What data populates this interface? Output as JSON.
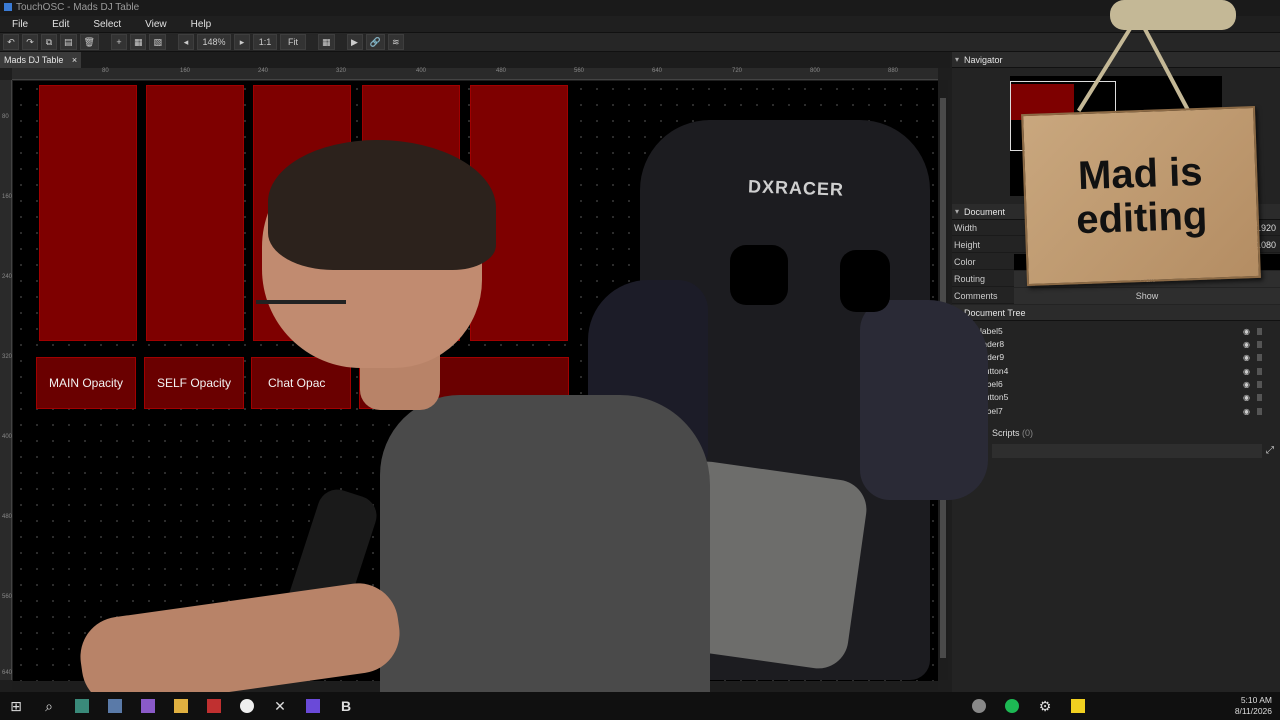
{
  "window": {
    "title": "TouchOSC - Mads DJ Table"
  },
  "menu": [
    "File",
    "Edit",
    "Select",
    "View",
    "Help"
  ],
  "toolbar": {
    "zoom": "148%",
    "one_to_one": "1:1",
    "fit": "Fit"
  },
  "document_tab": {
    "label": "Mads DJ Table",
    "close": "×"
  },
  "ruler_top": [
    "80",
    "160",
    "240",
    "320",
    "400",
    "480",
    "560",
    "640",
    "720",
    "800",
    "880"
  ],
  "ruler_left": [
    "80",
    "160",
    "240",
    "320",
    "400",
    "480",
    "560",
    "640"
  ],
  "canvas": {
    "buttons": [
      "MAIN Opacity",
      "SELF Opacity",
      "Chat Opac"
    ]
  },
  "panel": {
    "navigator_title": "Navigator",
    "document_title": "Document",
    "properties": {
      "width_label": "Width",
      "width_value": "1920",
      "height_label": "Height",
      "height_value": "1080",
      "color_label": "Color",
      "routing_label": "Routing",
      "routing_value": "Edit",
      "comments_label": "Comments",
      "comments_value": "Show"
    },
    "tree_title": "Document Tree",
    "tree_items": [
      "label5",
      "fader8",
      "fader9",
      "button4",
      "label6",
      "button5",
      "label7"
    ],
    "scripts_label": "Scripts",
    "scripts_count": "(0)"
  },
  "overlay": {
    "sign_line1": "Mad is",
    "sign_line2": "editing",
    "chair_brand": "DXRACER"
  },
  "clock": {
    "time": "5:10 AM",
    "date": "8/11/2026"
  },
  "colors": {
    "fader_red": "#7e0000",
    "panel_bg": "#232323",
    "canvas_bg": "#000000"
  }
}
